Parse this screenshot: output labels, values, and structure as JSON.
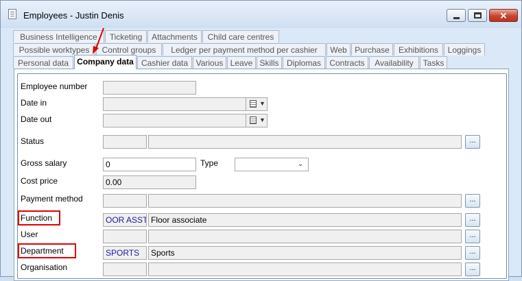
{
  "window": {
    "title": "Employees - Justin Denis",
    "minimize_icon": "minimize-icon",
    "maximize_icon": "maximize-icon",
    "close_icon": "close-icon"
  },
  "tabs": {
    "row1": [
      "Business Intelligence",
      "Ticketing",
      "Attachments",
      "Child care centres"
    ],
    "row2": [
      "Possible worktypes",
      "Control groups",
      "Ledger per payment method per cashier",
      "Web",
      "Purchase",
      "Exhibitions",
      "Loggings"
    ],
    "row3": [
      "Personal data",
      "Company data",
      "Cashier data",
      "Various",
      "Leave",
      "Skills",
      "Diplomas",
      "Contracts",
      "Availability",
      "Tasks"
    ],
    "active": "Company data"
  },
  "form": {
    "employee_number": {
      "label": "Employee number",
      "value": ""
    },
    "date_in": {
      "label": "Date in",
      "value": ""
    },
    "date_out": {
      "label": "Date out",
      "value": ""
    },
    "status": {
      "label": "Status",
      "code": "",
      "description": ""
    },
    "gross_salary": {
      "label": "Gross salary",
      "value": "0"
    },
    "type": {
      "label": "Type",
      "value": ""
    },
    "cost_price": {
      "label": "Cost price",
      "value": "0.00"
    },
    "payment_method": {
      "label": "Payment method",
      "code": "",
      "description": ""
    },
    "function": {
      "label": "Function",
      "code": "OOR ASST.",
      "description": "Floor associate"
    },
    "user": {
      "label": "User",
      "code": "",
      "description": ""
    },
    "department": {
      "label": "Department",
      "code": "SPORTS",
      "description": "Sports"
    },
    "organisation": {
      "label": "Organisation",
      "code": "",
      "description": ""
    },
    "lookup_button": "..."
  },
  "annotations": {
    "highlight_color": "#e00000"
  }
}
